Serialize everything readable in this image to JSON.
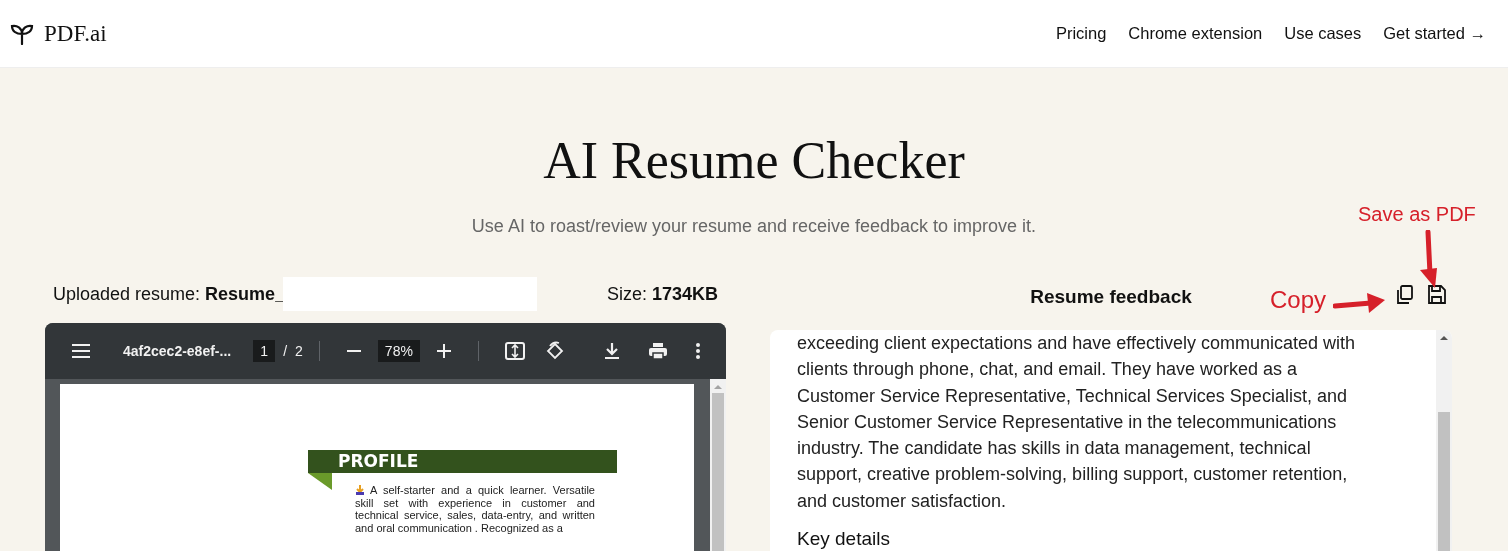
{
  "nav": {
    "logo": "PDF.ai",
    "links": [
      {
        "label": "Pricing"
      },
      {
        "label": "Chrome extension"
      },
      {
        "label": "Use cases"
      },
      {
        "label": "Get started →"
      }
    ]
  },
  "hero": {
    "title": "AI Resume Checker",
    "subtitle": "Use AI to roast/review your resume and receive feedback to improve it."
  },
  "upload": {
    "label": "Uploaded resume:",
    "filename": "Resume_",
    "size_label": "Size:",
    "size": "1734KB"
  },
  "viewer": {
    "filename": "4af2cec2-e8ef-...",
    "page": "1",
    "separator": "/",
    "pages": "2",
    "zoom": "78%",
    "document": {
      "heading": "PROFILE",
      "paragraph": "A self-starter and a quick learner. Versatile skill set with experience in customer and technical service, sales, data-entry, and written and oral communication . Recognized as a"
    }
  },
  "feedback": {
    "title": "Resume feedback",
    "paragraph": "exceeding client expectations and have effectively communicated with clients through phone, chat, and email. They have worked as a Customer Service Representative, Technical Services Specialist, and Senior Customer Service Representative in the telecommunications industry. The candidate has skills in data management, technical support, creative problem-solving, billing support, customer retention, and customer satisfaction.",
    "section_heading": "Key details"
  },
  "annotations": [
    {
      "kind": "save",
      "label": "Save as PDF"
    },
    {
      "kind": "copy",
      "label": "Copy"
    }
  ]
}
